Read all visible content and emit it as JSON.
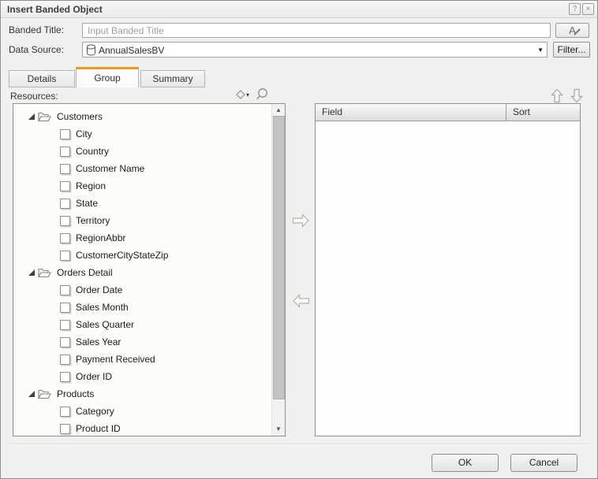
{
  "dialog": {
    "title": "Insert Banded Object",
    "help_glyph": "?",
    "close_glyph": "×"
  },
  "form": {
    "banded_title_label": "Banded Title:",
    "banded_title_placeholder": "Input Banded Title",
    "font_button_glyph": "A",
    "data_source_label": "Data Source:",
    "data_source_value": "AnnualSalesBV",
    "dropdown_glyph": "▼",
    "filter_button_label": "Filter..."
  },
  "tabs": [
    {
      "label": "Details",
      "active": false
    },
    {
      "label": "Group",
      "active": true
    },
    {
      "label": "Summary",
      "active": false
    }
  ],
  "resources": {
    "label": "Resources:",
    "sort_caret_glyph": "▾",
    "tree": [
      {
        "type": "folder",
        "label": "Customers",
        "expanded": true
      },
      {
        "type": "field",
        "label": "City",
        "checked": false
      },
      {
        "type": "field",
        "label": "Country",
        "checked": false
      },
      {
        "type": "field",
        "label": "Customer Name",
        "checked": false
      },
      {
        "type": "field",
        "label": "Region",
        "checked": false
      },
      {
        "type": "field",
        "label": "State",
        "checked": false
      },
      {
        "type": "field",
        "label": "Territory",
        "checked": false
      },
      {
        "type": "field",
        "label": "RegionAbbr",
        "checked": false
      },
      {
        "type": "field",
        "label": "CustomerCityStateZip",
        "checked": false
      },
      {
        "type": "folder",
        "label": "Orders Detail",
        "expanded": true
      },
      {
        "type": "field",
        "label": "Order Date",
        "checked": false
      },
      {
        "type": "field",
        "label": "Sales Month",
        "checked": false
      },
      {
        "type": "field",
        "label": "Sales Quarter",
        "checked": false
      },
      {
        "type": "field",
        "label": "Sales Year",
        "checked": false
      },
      {
        "type": "field",
        "label": "Payment Received",
        "checked": false
      },
      {
        "type": "field",
        "label": "Order ID",
        "checked": false
      },
      {
        "type": "folder",
        "label": "Products",
        "expanded": true
      },
      {
        "type": "field",
        "label": "Category",
        "checked": false
      },
      {
        "type": "field",
        "label": "Product ID",
        "checked": false
      }
    ],
    "scroll_up_glyph": "▲",
    "scroll_down_glyph": "▼"
  },
  "fields_table": {
    "columns": [
      "Field",
      "Sort"
    ],
    "rows": []
  },
  "footer": {
    "ok_label": "OK",
    "cancel_label": "Cancel"
  },
  "colors": {
    "accent_orange": "#F7941E",
    "panel_bg": "#FBFDF7",
    "dialog_bg": "#F0F0EF"
  }
}
